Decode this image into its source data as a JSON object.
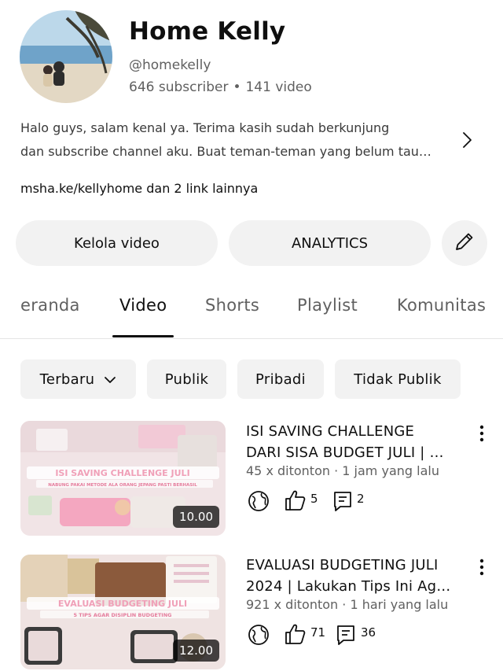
{
  "channel": {
    "name": "Home Kelly",
    "handle": "@homekelly",
    "subscribers": "646 subscriber",
    "separator": "•",
    "videos": "141 video",
    "description_line1": "Halo guys, salam kenal ya. Terima kasih sudah berkunjung",
    "description_line2": "dan subscribe channel aku. Buat teman-teman yang belum tau…",
    "links": "msha.ke/kellyhome dan 2 link lainnya"
  },
  "actions": {
    "manage_videos": "Kelola video",
    "analytics": "ANALYTICS"
  },
  "tabs": [
    "eranda",
    "Video",
    "Shorts",
    "Playlist",
    "Komunitas"
  ],
  "active_tab": "Video",
  "filters": {
    "sort": "Terbaru",
    "public": "Publik",
    "private": "Pribadi",
    "unlisted": "Tidak Publik"
  },
  "videos": [
    {
      "title_line1": "ISI SAVING CHALLENGE",
      "title_line2": "DARI SISA BUDGET JULI | …",
      "views": "45 x ditonton",
      "age": "1 jam yang lalu",
      "likes": "5",
      "comments": "2",
      "duration": "10.00",
      "thumb_text1": "ISI SAVING CHALLENGE JULI",
      "thumb_text2": "NABUNG PAKAI METODE ALA ORANG JEPANG PASTI BERHASIL"
    },
    {
      "title_line1": "EVALUASI BUDGETING JULI",
      "title_line2": "2024 | Lakukan Tips Ini Ag…",
      "views": "921 x ditonton",
      "age": "1 hari yang lalu",
      "likes": "71",
      "comments": "36",
      "duration": "12.00",
      "thumb_text1": "EVALUASI BUDGETING JULI",
      "thumb_text2": "5 TIPS AGAR DISIPLIN BUDGETING"
    }
  ],
  "colors": {
    "text_primary": "#0f0f0f",
    "text_secondary": "#606060",
    "chip_bg": "#f2f2f2",
    "thumb_accent": "#f7a8c0"
  }
}
